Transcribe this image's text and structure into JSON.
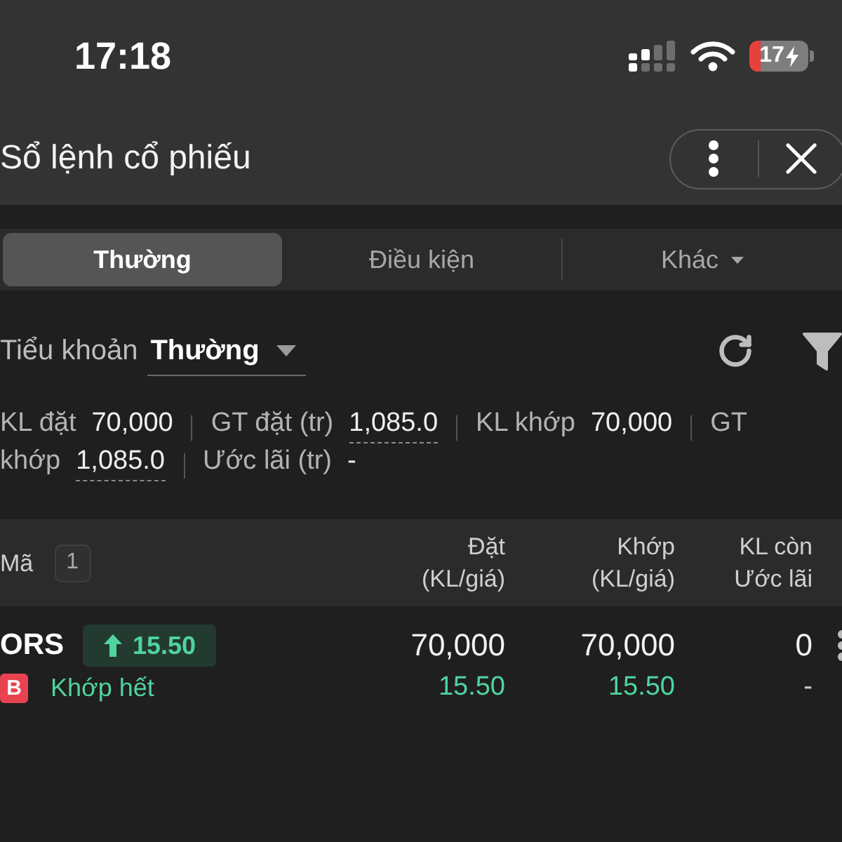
{
  "status_bar": {
    "time": "17:18",
    "battery": "17"
  },
  "header": {
    "title": "Sổ lệnh cổ phiếu"
  },
  "tabs": [
    {
      "label": "Thường",
      "selected": true,
      "kind": "plain"
    },
    {
      "label": "Điều kiện",
      "selected": false,
      "kind": "plain"
    },
    {
      "label": "Khác",
      "selected": false,
      "kind": "dropdown"
    }
  ],
  "account": {
    "label": "Tiểu khoản",
    "value": "Thường"
  },
  "summary": {
    "lines": [
      {
        "items": [
          {
            "label": "KL đặt",
            "value": "70,000",
            "dashed": false
          },
          {
            "label": "GT đặt (tr)",
            "value": "1,085.0",
            "dashed": true
          },
          {
            "label": "KL khớp",
            "value": "70,000",
            "dashed": false
          },
          {
            "label": "GT"
          }
        ]
      },
      {
        "items": [
          {
            "label": "khớp",
            "value": "1,085.0",
            "dashed": true
          },
          {
            "label": "Ước lãi (tr)",
            "value": "-",
            "dashed": false
          }
        ]
      }
    ]
  },
  "table": {
    "symbol_header": "Mã",
    "count": "1",
    "columns": [
      {
        "lines": [
          "Đặt",
          "(KL/giá)"
        ]
      },
      {
        "lines": [
          "Khớp",
          "(KL/giá)"
        ]
      },
      {
        "lines": [
          "KL còn",
          "Ước lãi"
        ]
      }
    ],
    "rows": [
      {
        "symbol": "ORS",
        "change": {
          "rising": true,
          "value": "15.50"
        },
        "side": {
          "label": "B",
          "color": "#e8434f"
        },
        "status": "Khớp hết",
        "cells": [
          {
            "main": "70,000",
            "sub": "15.50",
            "sub_rising": true
          },
          {
            "main": "70,000",
            "sub": "15.50",
            "sub_rising": true
          },
          {
            "main": "0",
            "sub": "-",
            "sub_rising": false
          }
        ]
      }
    ]
  }
}
